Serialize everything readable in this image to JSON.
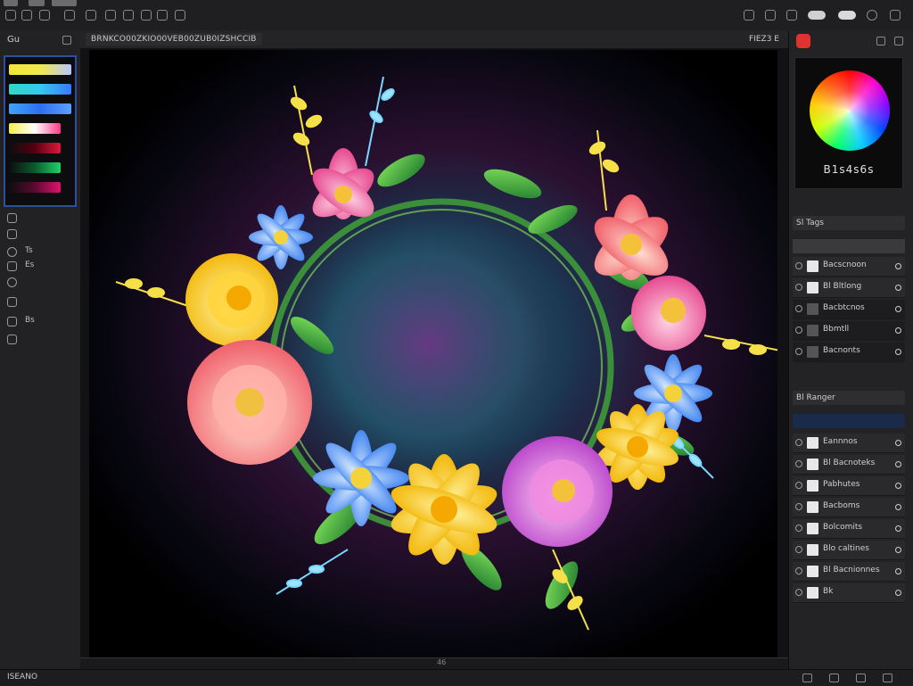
{
  "canvas_header": {
    "document_tab": "BRNKCO00ZKIO00VEB00ZUB0IZSHCCIB",
    "zoom": "FIEZ3 E"
  },
  "left_panel": {
    "title": "Gu",
    "swatches": [
      "#f3e53a",
      "#39d4e6",
      "#3a78ff",
      "#f6ef4a",
      "#e0183c",
      "#1fd36a",
      "#e0126e"
    ],
    "tools": [
      "",
      "",
      "Ts",
      "Es",
      "",
      "",
      "Bs",
      ""
    ]
  },
  "right_panel": {
    "color_readout": "B1s4s6s",
    "section_layers": "Sl Tags",
    "layers": [
      {
        "name": "Bacscnoon",
        "dark": false
      },
      {
        "name": "Bl Bltlong",
        "dark": false
      },
      {
        "name": "Bacbtcnos",
        "dark": true
      },
      {
        "name": "Bbmtll",
        "dark": true
      },
      {
        "name": "Bacnonts",
        "dark": true
      }
    ],
    "section_group": "Bl Ranger",
    "group_layers": [
      {
        "name": "Eannnos",
        "dark": false
      },
      {
        "name": "Bl Bacnoteks",
        "dark": false
      },
      {
        "name": "Pabhutes",
        "dark": false
      },
      {
        "name": "Bacboms",
        "dark": false
      },
      {
        "name": "Bolcomits",
        "dark": false
      },
      {
        "name": "Blo caltines",
        "dark": false
      },
      {
        "name": "Bl Bacnionnes",
        "dark": false
      },
      {
        "name": "Bk",
        "dark": false
      }
    ]
  },
  "statusbar": {
    "left_text": "ISEANO"
  },
  "ruler": {
    "mark": "46"
  }
}
